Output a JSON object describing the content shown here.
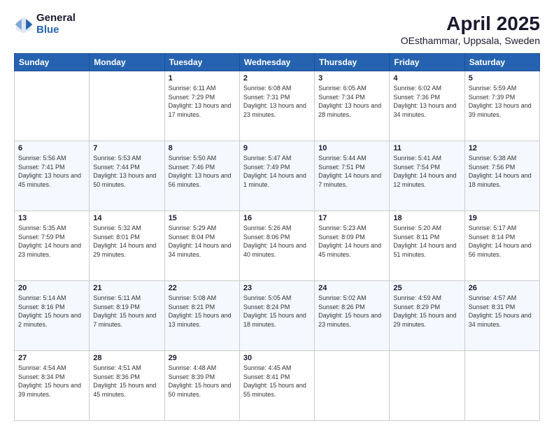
{
  "header": {
    "logo_line1": "General",
    "logo_line2": "Blue",
    "title": "April 2025",
    "subtitle": "OEsthammar, Uppsala, Sweden"
  },
  "days_of_week": [
    "Sunday",
    "Monday",
    "Tuesday",
    "Wednesday",
    "Thursday",
    "Friday",
    "Saturday"
  ],
  "weeks": [
    [
      {
        "day": "",
        "info": ""
      },
      {
        "day": "",
        "info": ""
      },
      {
        "day": "1",
        "info": "Sunrise: 6:11 AM\nSunset: 7:29 PM\nDaylight: 13 hours and 17 minutes."
      },
      {
        "day": "2",
        "info": "Sunrise: 6:08 AM\nSunset: 7:31 PM\nDaylight: 13 hours and 23 minutes."
      },
      {
        "day": "3",
        "info": "Sunrise: 6:05 AM\nSunset: 7:34 PM\nDaylight: 13 hours and 28 minutes."
      },
      {
        "day": "4",
        "info": "Sunrise: 6:02 AM\nSunset: 7:36 PM\nDaylight: 13 hours and 34 minutes."
      },
      {
        "day": "5",
        "info": "Sunrise: 5:59 AM\nSunset: 7:39 PM\nDaylight: 13 hours and 39 minutes."
      }
    ],
    [
      {
        "day": "6",
        "info": "Sunrise: 5:56 AM\nSunset: 7:41 PM\nDaylight: 13 hours and 45 minutes."
      },
      {
        "day": "7",
        "info": "Sunrise: 5:53 AM\nSunset: 7:44 PM\nDaylight: 13 hours and 50 minutes."
      },
      {
        "day": "8",
        "info": "Sunrise: 5:50 AM\nSunset: 7:46 PM\nDaylight: 13 hours and 56 minutes."
      },
      {
        "day": "9",
        "info": "Sunrise: 5:47 AM\nSunset: 7:49 PM\nDaylight: 14 hours and 1 minute."
      },
      {
        "day": "10",
        "info": "Sunrise: 5:44 AM\nSunset: 7:51 PM\nDaylight: 14 hours and 7 minutes."
      },
      {
        "day": "11",
        "info": "Sunrise: 5:41 AM\nSunset: 7:54 PM\nDaylight: 14 hours and 12 minutes."
      },
      {
        "day": "12",
        "info": "Sunrise: 5:38 AM\nSunset: 7:56 PM\nDaylight: 14 hours and 18 minutes."
      }
    ],
    [
      {
        "day": "13",
        "info": "Sunrise: 5:35 AM\nSunset: 7:59 PM\nDaylight: 14 hours and 23 minutes."
      },
      {
        "day": "14",
        "info": "Sunrise: 5:32 AM\nSunset: 8:01 PM\nDaylight: 14 hours and 29 minutes."
      },
      {
        "day": "15",
        "info": "Sunrise: 5:29 AM\nSunset: 8:04 PM\nDaylight: 14 hours and 34 minutes."
      },
      {
        "day": "16",
        "info": "Sunrise: 5:26 AM\nSunset: 8:06 PM\nDaylight: 14 hours and 40 minutes."
      },
      {
        "day": "17",
        "info": "Sunrise: 5:23 AM\nSunset: 8:09 PM\nDaylight: 14 hours and 45 minutes."
      },
      {
        "day": "18",
        "info": "Sunrise: 5:20 AM\nSunset: 8:11 PM\nDaylight: 14 hours and 51 minutes."
      },
      {
        "day": "19",
        "info": "Sunrise: 5:17 AM\nSunset: 8:14 PM\nDaylight: 14 hours and 56 minutes."
      }
    ],
    [
      {
        "day": "20",
        "info": "Sunrise: 5:14 AM\nSunset: 8:16 PM\nDaylight: 15 hours and 2 minutes."
      },
      {
        "day": "21",
        "info": "Sunrise: 5:11 AM\nSunset: 8:19 PM\nDaylight: 15 hours and 7 minutes."
      },
      {
        "day": "22",
        "info": "Sunrise: 5:08 AM\nSunset: 8:21 PM\nDaylight: 15 hours and 13 minutes."
      },
      {
        "day": "23",
        "info": "Sunrise: 5:05 AM\nSunset: 8:24 PM\nDaylight: 15 hours and 18 minutes."
      },
      {
        "day": "24",
        "info": "Sunrise: 5:02 AM\nSunset: 8:26 PM\nDaylight: 15 hours and 23 minutes."
      },
      {
        "day": "25",
        "info": "Sunrise: 4:59 AM\nSunset: 8:29 PM\nDaylight: 15 hours and 29 minutes."
      },
      {
        "day": "26",
        "info": "Sunrise: 4:57 AM\nSunset: 8:31 PM\nDaylight: 15 hours and 34 minutes."
      }
    ],
    [
      {
        "day": "27",
        "info": "Sunrise: 4:54 AM\nSunset: 8:34 PM\nDaylight: 15 hours and 39 minutes."
      },
      {
        "day": "28",
        "info": "Sunrise: 4:51 AM\nSunset: 8:36 PM\nDaylight: 15 hours and 45 minutes."
      },
      {
        "day": "29",
        "info": "Sunrise: 4:48 AM\nSunset: 8:39 PM\nDaylight: 15 hours and 50 minutes."
      },
      {
        "day": "30",
        "info": "Sunrise: 4:45 AM\nSunset: 8:41 PM\nDaylight: 15 hours and 55 minutes."
      },
      {
        "day": "",
        "info": ""
      },
      {
        "day": "",
        "info": ""
      },
      {
        "day": "",
        "info": ""
      }
    ]
  ]
}
